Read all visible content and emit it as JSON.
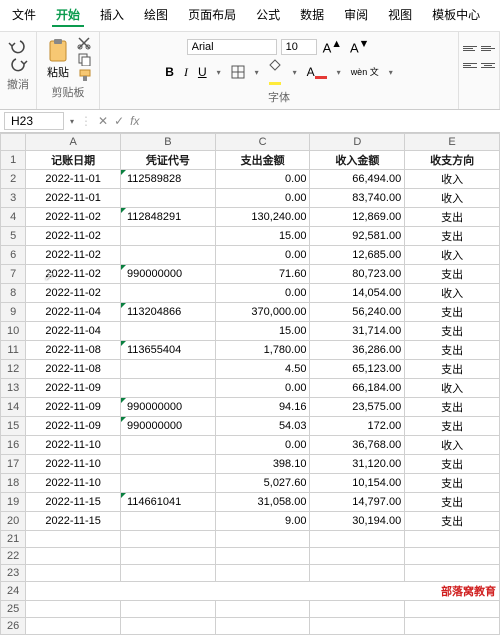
{
  "menu": {
    "file": "文件",
    "home": "开始",
    "insert": "插入",
    "draw": "绘图",
    "layout": "页面布局",
    "formula": "公式",
    "data": "数据",
    "review": "审阅",
    "view": "视图",
    "template": "模板中心"
  },
  "ribbon": {
    "undo_label": "撤消",
    "clipboard_label": "剪贴板",
    "paste_label": "粘贴",
    "font_label": "字体",
    "font_name": "Arial",
    "font_size": "10",
    "wen": "wèn\n文"
  },
  "namebox": "H23",
  "fx": "fx",
  "cols": [
    "A",
    "B",
    "C",
    "D",
    "E"
  ],
  "headers": {
    "date": "记账日期",
    "voucher": "凭证代号",
    "out": "支出金额",
    "in": "收入金额",
    "dir": "收支方向"
  },
  "rows": [
    {
      "date": "2022-11-01",
      "v": "112589828",
      "out": "0.00",
      "in": "66,494.00",
      "dir": "收入",
      "tri": true
    },
    {
      "date": "2022-11-01",
      "v": "",
      "out": "0.00",
      "in": "83,740.00",
      "dir": "收入",
      "tri": false
    },
    {
      "date": "2022-11-02",
      "v": "112848291",
      "out": "130,240.00",
      "in": "12,869.00",
      "dir": "支出",
      "tri": true
    },
    {
      "date": "2022-11-02",
      "v": "",
      "out": "15.00",
      "in": "92,581.00",
      "dir": "支出",
      "tri": false
    },
    {
      "date": "2022-11-02",
      "v": "",
      "out": "0.00",
      "in": "12,685.00",
      "dir": "收入",
      "tri": false
    },
    {
      "date": "2022-11-02",
      "v": "990000000",
      "out": "71.60",
      "in": "80,723.00",
      "dir": "支出",
      "tri": true,
      "cursor": true
    },
    {
      "date": "2022-11-02",
      "v": "",
      "out": "0.00",
      "in": "14,054.00",
      "dir": "收入",
      "tri": false
    },
    {
      "date": "2022-11-04",
      "v": "113204866",
      "out": "370,000.00",
      "in": "56,240.00",
      "dir": "支出",
      "tri": true
    },
    {
      "date": "2022-11-04",
      "v": "",
      "out": "15.00",
      "in": "31,714.00",
      "dir": "支出",
      "tri": false
    },
    {
      "date": "2022-11-08",
      "v": "113655404",
      "out": "1,780.00",
      "in": "36,286.00",
      "dir": "支出",
      "tri": true
    },
    {
      "date": "2022-11-08",
      "v": "",
      "out": "4.50",
      "in": "65,123.00",
      "dir": "支出",
      "tri": false
    },
    {
      "date": "2022-11-09",
      "v": "",
      "out": "0.00",
      "in": "66,184.00",
      "dir": "收入",
      "tri": false
    },
    {
      "date": "2022-11-09",
      "v": "990000000",
      "out": "94.16",
      "in": "23,575.00",
      "dir": "支出",
      "tri": true
    },
    {
      "date": "2022-11-09",
      "v": "990000000",
      "out": "54.03",
      "in": "172.00",
      "dir": "支出",
      "tri": true
    },
    {
      "date": "2022-11-10",
      "v": "",
      "out": "0.00",
      "in": "36,768.00",
      "dir": "收入",
      "tri": false
    },
    {
      "date": "2022-11-10",
      "v": "",
      "out": "398.10",
      "in": "31,120.00",
      "dir": "支出",
      "tri": false
    },
    {
      "date": "2022-11-10",
      "v": "",
      "out": "5,027.60",
      "in": "10,154.00",
      "dir": "支出",
      "tri": false
    },
    {
      "date": "2022-11-15",
      "v": "114661041",
      "out": "31,058.00",
      "in": "14,797.00",
      "dir": "支出",
      "tri": true
    },
    {
      "date": "2022-11-15",
      "v": "",
      "out": "9.00",
      "in": "30,194.00",
      "dir": "支出",
      "tri": false
    }
  ],
  "watermark": "部落窝教育"
}
